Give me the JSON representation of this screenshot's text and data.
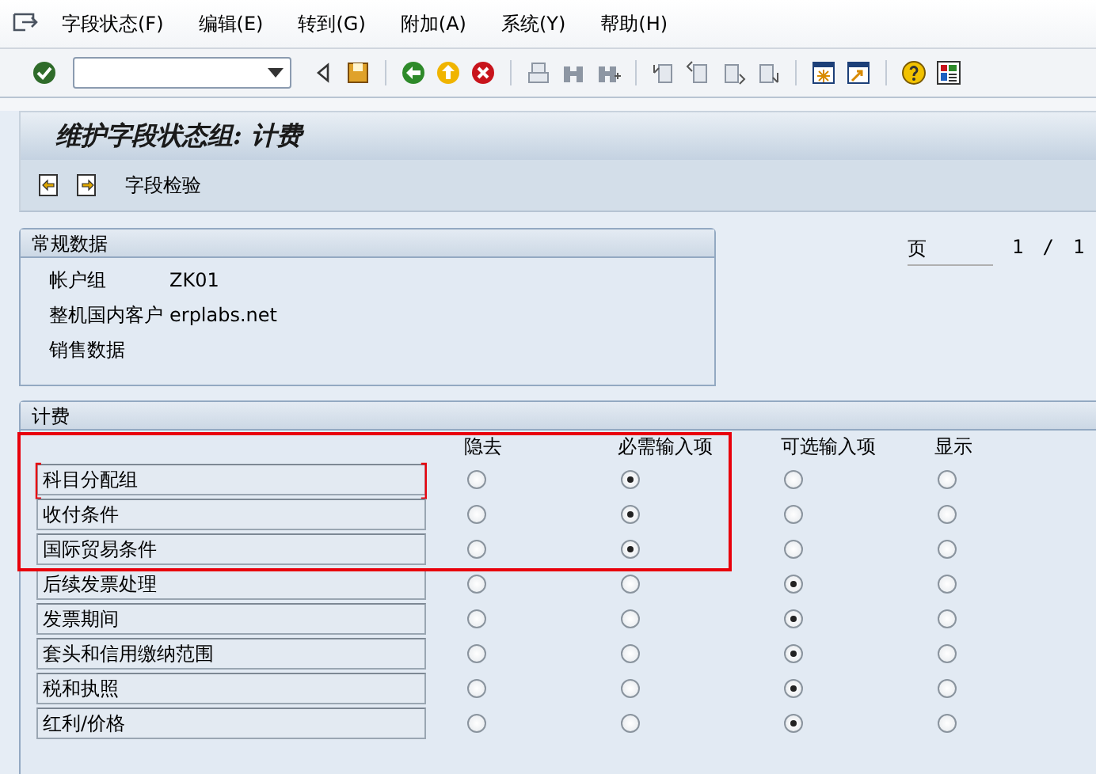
{
  "menu": [
    "字段状态(F)",
    "编辑(E)",
    "转到(G)",
    "附加(A)",
    "系统(Y)",
    "帮助(H)"
  ],
  "title": "维护字段状态组: 计费",
  "app_toolbar": {
    "button": "字段检验"
  },
  "general_data": {
    "title": "常规数据",
    "fields": [
      {
        "label": "帐户组",
        "value": "ZK01"
      },
      {
        "label": "整机国内客户",
        "value": "erplabs.net"
      },
      {
        "label": "销售数据"
      }
    ]
  },
  "pager": {
    "label": "页",
    "current": "1",
    "separator": "/",
    "total": "1"
  },
  "billing": {
    "title": "计费",
    "columns": [
      "隐去",
      "必需输入项",
      "可选输入项",
      "显示"
    ],
    "rows": [
      {
        "label": "科目分配组",
        "focused": true,
        "highlighted": true,
        "options": [
          {
            "selected": false
          },
          {
            "selected": true
          },
          {
            "selected": false
          },
          {
            "selected": false
          }
        ]
      },
      {
        "label": "收付条件",
        "focused": false,
        "highlighted": true,
        "options": [
          {
            "selected": false
          },
          {
            "selected": true
          },
          {
            "selected": false
          },
          {
            "selected": false
          }
        ]
      },
      {
        "label": "国际贸易条件",
        "focused": false,
        "highlighted": true,
        "options": [
          {
            "selected": false
          },
          {
            "selected": true
          },
          {
            "selected": false
          },
          {
            "selected": false
          }
        ]
      },
      {
        "label": "后续发票处理",
        "focused": false,
        "highlighted": false,
        "options": [
          {
            "selected": false
          },
          {
            "selected": false
          },
          {
            "selected": true
          },
          {
            "selected": false
          }
        ]
      },
      {
        "label": "发票期间",
        "focused": false,
        "highlighted": false,
        "options": [
          {
            "selected": false
          },
          {
            "selected": false
          },
          {
            "selected": true
          },
          {
            "selected": false
          }
        ]
      },
      {
        "label": "套头和信用缴纳范围",
        "focused": false,
        "highlighted": false,
        "options": [
          {
            "selected": false
          },
          {
            "selected": false
          },
          {
            "selected": true
          },
          {
            "selected": false
          }
        ]
      },
      {
        "label": "税和执照",
        "focused": false,
        "highlighted": false,
        "options": [
          {
            "selected": false
          },
          {
            "selected": false
          },
          {
            "selected": true
          },
          {
            "selected": false
          }
        ]
      },
      {
        "label": "红利/价格",
        "focused": false,
        "highlighted": false,
        "options": [
          {
            "selected": false
          },
          {
            "selected": false
          },
          {
            "selected": true
          },
          {
            "selected": false
          }
        ]
      }
    ]
  }
}
